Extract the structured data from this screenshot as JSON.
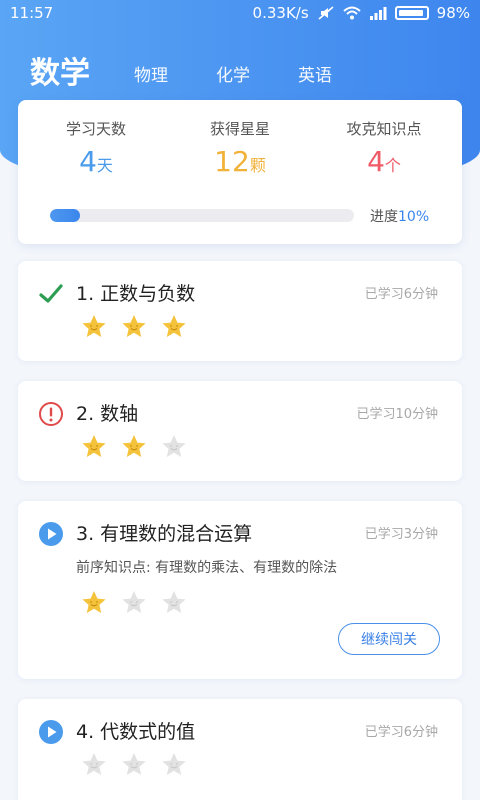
{
  "status_bar": {
    "time": "11:57",
    "network_speed": "0.33K/s",
    "battery": "98%"
  },
  "subjects": {
    "active": "数学",
    "tabs": [
      "物理",
      "化学",
      "英语"
    ]
  },
  "stats": {
    "days": {
      "label": "学习天数",
      "value": "4",
      "unit": "天",
      "color": "#4a9bec"
    },
    "stars": {
      "label": "获得星星",
      "value": "12",
      "unit": "颗",
      "color": "#f1b23a"
    },
    "points": {
      "label": "攻克知识点",
      "value": "4",
      "unit": "个",
      "color": "#ef5a66"
    },
    "progress_label": "进度",
    "progress_value": "10%",
    "progress_fraction": 0.1
  },
  "lessons": [
    {
      "status": "check-icon",
      "title": "1. 正数与负数",
      "time": "已学习6分钟",
      "stars": 3
    },
    {
      "status": "warning-icon",
      "title": "2. 数轴",
      "time": "已学习10分钟",
      "stars": 2
    },
    {
      "status": "play-icon",
      "title": "3. 有理数的混合运算",
      "time": "已学习3分钟",
      "prereq": "前序知识点: 有理数的乘法、有理数的除法",
      "stars": 1,
      "button": "继续闯关"
    },
    {
      "status": "play-icon",
      "title": "4. 代数式的值",
      "time": "已学习6分钟",
      "stars": 0
    }
  ],
  "colors": {
    "accent": "#3e86ee",
    "star_gold": "#f5c33b",
    "star_gray": "#e2e2e2",
    "check_green": "#2e9d54",
    "warning_red": "#e04a4a",
    "play_blue": "#4a9bec"
  }
}
